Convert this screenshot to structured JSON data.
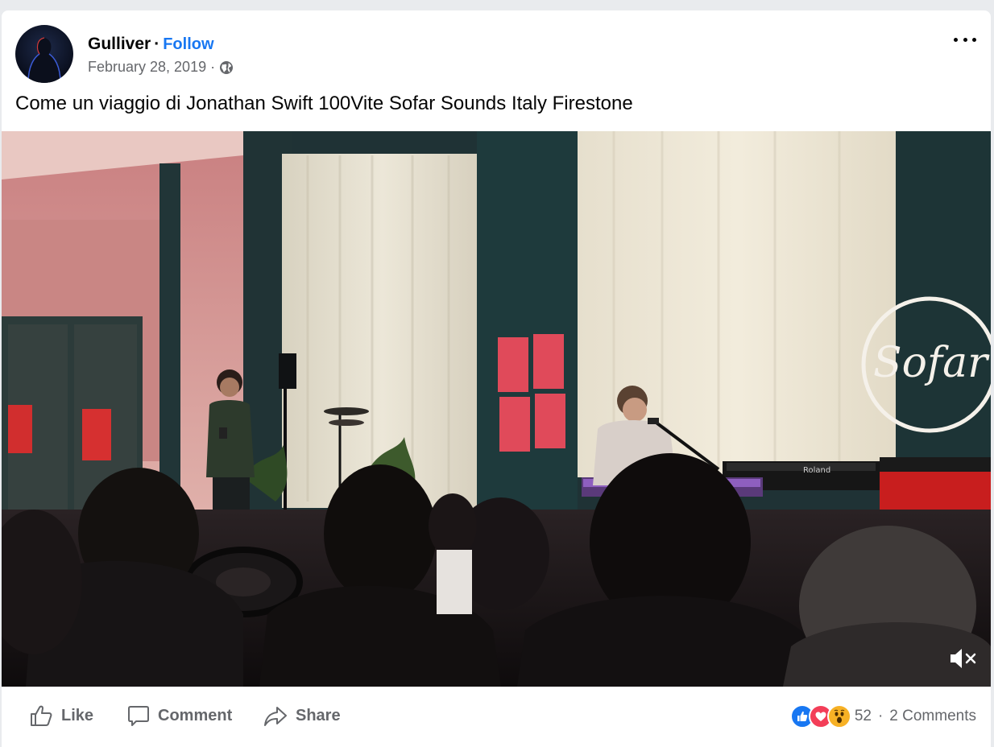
{
  "post": {
    "author": "Gulliver",
    "follow_label": "Follow",
    "date": "February 28, 2019",
    "separator": "·",
    "caption": "Come un viaggio di Jonathan Swift 100Vite Sofar Sounds Italy Firestone"
  },
  "video": {
    "logo_text": "Sofar",
    "keyboard_text": "Roland",
    "muted": true
  },
  "actions": {
    "like_label": "Like",
    "comment_label": "Comment",
    "share_label": "Share"
  },
  "reactions": {
    "icons": [
      "like-icon",
      "love-icon",
      "wow-icon"
    ],
    "count": "52",
    "separator": "·",
    "comments": "2 Comments"
  },
  "colors": {
    "accent": "#1877f2",
    "secondary_text": "#65676b",
    "love": "#f33e58",
    "wow": "#f7b125"
  }
}
